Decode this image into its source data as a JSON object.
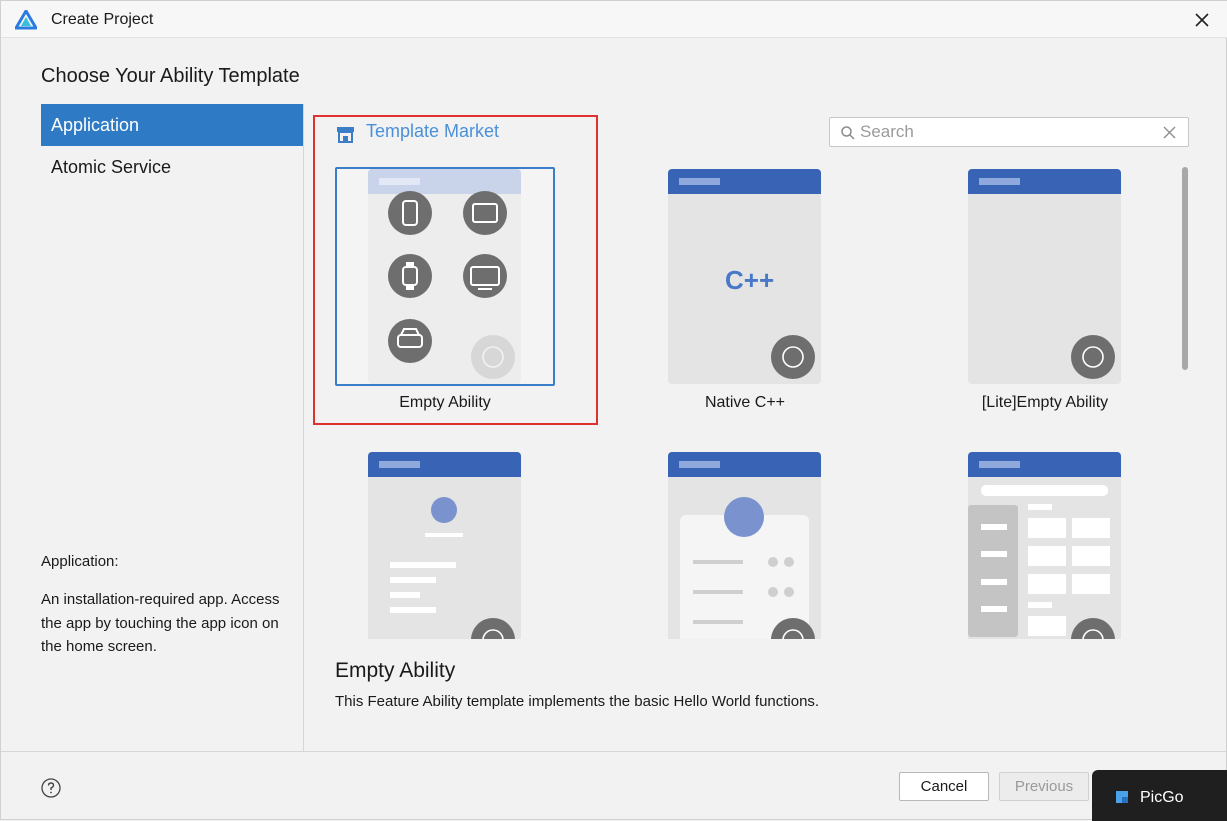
{
  "window": {
    "title": "Create Project"
  },
  "heading": "Choose Your Ability Template",
  "sidebar": {
    "items": [
      {
        "label": "Application",
        "active": true
      },
      {
        "label": "Atomic Service",
        "active": false
      }
    ],
    "description_title": "Application:",
    "description": "An installation-required app. Access the app by touching the app icon on the home screen."
  },
  "market": {
    "label": "Template Market"
  },
  "search": {
    "placeholder": "Search",
    "value": ""
  },
  "templates": [
    {
      "label": "Empty Ability",
      "selected": true
    },
    {
      "label": "Native C++",
      "selected": false
    },
    {
      "label": "[Lite]Empty Ability",
      "selected": false
    }
  ],
  "native_logo": "C++",
  "detail": {
    "title": "Empty Ability",
    "text": "This Feature Ability template implements the basic Hello World functions."
  },
  "footer": {
    "cancel_label": "Cancel",
    "previous_label": "Previous"
  },
  "taskbar": {
    "label": "PicGo"
  },
  "colors": {
    "accent": "#2f7ac5",
    "header_bar": "#3963b5",
    "highlight_border": "#e03131",
    "link": "#4a90d9"
  }
}
